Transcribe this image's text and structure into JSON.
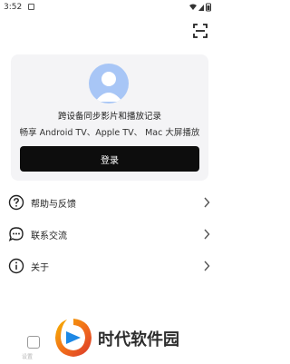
{
  "status_bar": {
    "time": "3:52"
  },
  "header": {
    "scan_icon": "scan-icon"
  },
  "login_card": {
    "title": "跨设备同步影片和播放记录",
    "subtitle": "畅享 Android TV、Apple TV、 Mac 大屏播放",
    "login_label": "登录",
    "avatar_color": "#a8c6f6"
  },
  "menu": {
    "items": [
      {
        "label": "帮助与反馈",
        "icon": "help-icon"
      },
      {
        "label": "联系交流",
        "icon": "chat-icon"
      },
      {
        "label": "关于",
        "icon": "info-icon"
      }
    ]
  },
  "bottom_nav": {
    "label": "设置"
  },
  "watermark": {
    "text": "时代软件园"
  },
  "colors": {
    "accent": "#0d0d0d",
    "card_background": "#f4f4f6"
  }
}
